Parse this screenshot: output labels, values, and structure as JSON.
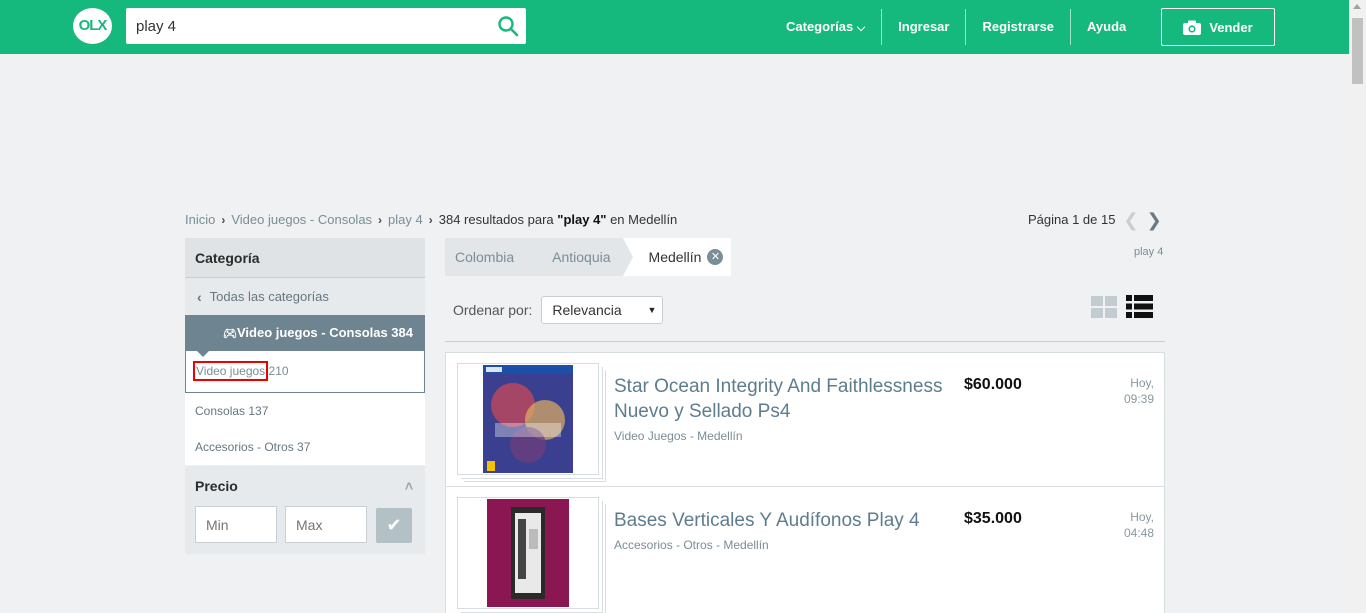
{
  "header": {
    "logo": "OLX",
    "search_value": "play 4",
    "nav": [
      "Categorías",
      "Ingresar",
      "Registrarse",
      "Ayuda"
    ],
    "sell_label": "Vender",
    "brand_color": "#16b97d"
  },
  "breadcrumb": {
    "items": [
      "Inicio",
      "Video juegos - Consolas",
      "play 4"
    ],
    "results_prefix": "384 resultados para ",
    "query": "\"play 4\"",
    "results_suffix": " en Medellín"
  },
  "pager": {
    "label": "Página 1 de 15"
  },
  "sidebar": {
    "category_title": "Categoría",
    "back_label": "Todas las categorías",
    "active_label": "Video juegos - Consolas 384",
    "sub_items": [
      {
        "label": "Video juegos",
        "count": "210"
      },
      {
        "label": "Consolas",
        "count": "137"
      },
      {
        "label": "Accesorios - Otros",
        "count": "37"
      }
    ],
    "price_title": "Precio",
    "min_placeholder": "Min",
    "max_placeholder": "Max"
  },
  "location": {
    "tabs": [
      "Colombia",
      "Antioquia",
      "Medellín"
    ],
    "tag": "play 4"
  },
  "sort": {
    "label": "Ordenar por:",
    "selected": "Relevancia"
  },
  "listings": [
    {
      "title": "Star Ocean Integrity And Faithlessness Nuevo y Sellado Ps4",
      "subtitle": "Video Juegos - Medellín",
      "price": "$60.000",
      "date_day": "Hoy,",
      "date_time": "09:39"
    },
    {
      "title": "Bases Verticales Y Audífonos Play 4",
      "subtitle": "Accesorios - Otros - Medellín",
      "price": "$35.000",
      "date_day": "Hoy,",
      "date_time": "04:48"
    }
  ]
}
